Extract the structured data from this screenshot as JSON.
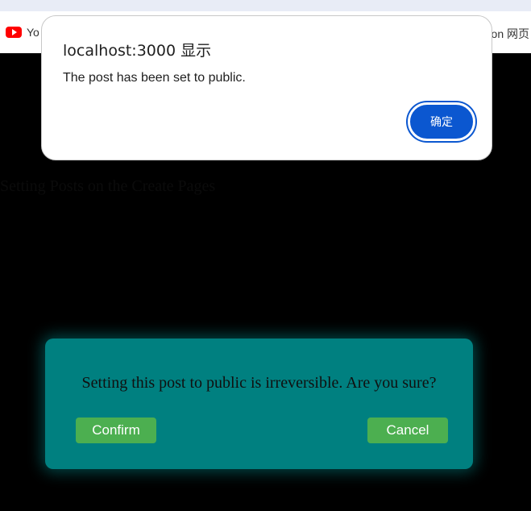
{
  "browser": {
    "bookmark_left_label": "Yo",
    "bookmark_right_label": "non 网页"
  },
  "background": {
    "heading": "Setting Posts on the Create Pages"
  },
  "alert": {
    "title": "localhost:3000 显示",
    "message": "The post has been set to public.",
    "ok_label": "确定"
  },
  "modal": {
    "message": "Setting this post to public is irreversible. Are you sure?",
    "confirm_label": "Confirm",
    "cancel_label": "Cancel"
  },
  "colors": {
    "modal_bg": "#008080",
    "button_green": "#4caf50",
    "alert_button": "#0b57d0",
    "youtube_red": "#ff0000"
  }
}
